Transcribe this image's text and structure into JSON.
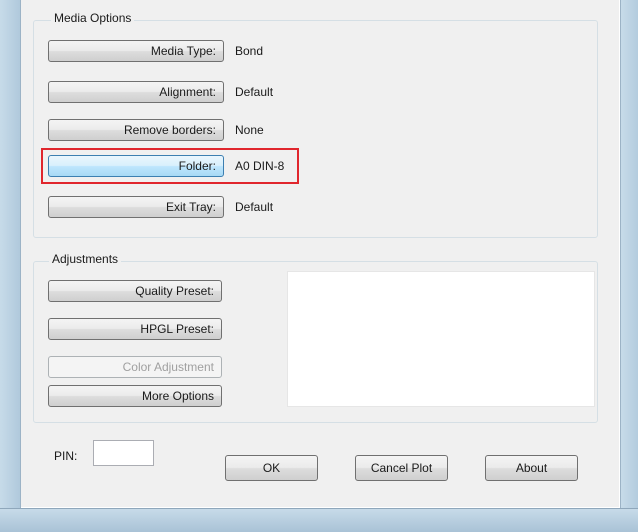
{
  "media_options": {
    "title": "Media Options",
    "rows": [
      {
        "button": "Media Type:",
        "value": "Bond"
      },
      {
        "button": "Alignment:",
        "value": "Default"
      },
      {
        "button": "Remove borders:",
        "value": "None"
      },
      {
        "button": "Folder:",
        "value": "A0 DIN-8"
      },
      {
        "button": "Exit Tray:",
        "value": "Default"
      }
    ]
  },
  "adjustments": {
    "title": "Adjustments",
    "quality_preset": "Quality Preset:",
    "hpgl_preset": "HPGL Preset:",
    "color_adjustment": "Color Adjustment",
    "more_options": "More Options"
  },
  "footer": {
    "pin_label": "PIN:",
    "pin_value": "",
    "ok": "OK",
    "cancel_plot": "Cancel Plot",
    "about": "About"
  },
  "colors": {
    "highlight": "#e0262d",
    "focus_border": "#3c7fb1"
  }
}
